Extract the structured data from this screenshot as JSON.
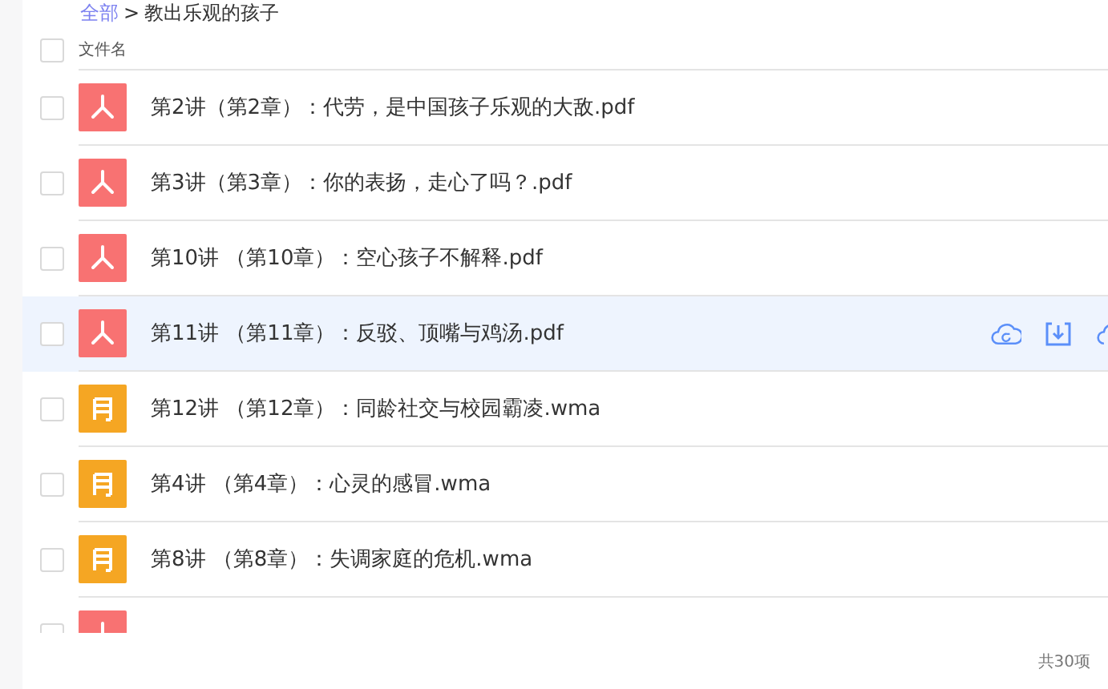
{
  "breadcrumb": {
    "root": "全部",
    "separator": ">",
    "current": "教出乐观的孩子"
  },
  "table": {
    "columns": [
      "文件名"
    ],
    "header_checked": false,
    "rows": [
      {
        "kind": "pdf",
        "name": "第2讲（第2章）：代劳，是中国孩子乐观的大敌.pdf",
        "checked": false,
        "hovered": false
      },
      {
        "kind": "pdf",
        "name": "第3讲（第3章）：你的表扬，走心了吗？.pdf",
        "checked": false,
        "hovered": false
      },
      {
        "kind": "pdf",
        "name": "第10讲 （第10章）：空心孩子不解释.pdf",
        "checked": false,
        "hovered": false
      },
      {
        "kind": "pdf",
        "name": "第11讲 （第11章）：反驳、顶嘴与鸡汤.pdf",
        "checked": false,
        "hovered": true
      },
      {
        "kind": "audio",
        "name": "第12讲 （第12章）：同龄社交与校园霸凌.wma",
        "checked": false,
        "hovered": false
      },
      {
        "kind": "audio",
        "name": "第4讲 （第4章）：心灵的感冒.wma",
        "checked": false,
        "hovered": false
      },
      {
        "kind": "audio",
        "name": "第8讲 （第8章）：失调家庭的危机.wma",
        "checked": false,
        "hovered": false
      },
      {
        "kind": "pdf",
        "checked": false,
        "hovered": false
      }
    ]
  },
  "footer": {
    "count": "共30项"
  }
}
